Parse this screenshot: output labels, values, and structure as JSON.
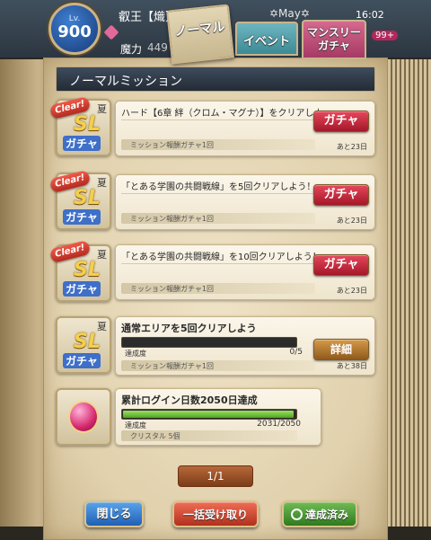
{
  "status": {
    "level_label": "Lv.",
    "level": "900",
    "player_name": "叡王【熾】",
    "player_sub": "✡May✡",
    "power_label": "魔力",
    "power_value": "449",
    "clock": "16:02",
    "badge": "99+"
  },
  "tabs": [
    {
      "label": "ノーマル"
    },
    {
      "label": "イベント"
    },
    {
      "label": "マンスリー\nガチャ"
    }
  ],
  "header": {
    "title": "ノーマルミッション"
  },
  "icon_common": {
    "clear_tag": "Clear!",
    "summer": "夏",
    "sl": "SL",
    "gacha": "ガチャ"
  },
  "missions": [
    {
      "title": "ハード【6章 絆（クロム・マグナ）】をクリアしよう",
      "reward": "ミッション報酬ガチャ1回",
      "button": "ガチャ",
      "remaining": "あと23日"
    },
    {
      "title": "「とある学園の共闘戦線」を5回クリアしよう！",
      "reward": "ミッション報酬ガチャ1回",
      "button": "ガチャ",
      "remaining": "あと23日"
    },
    {
      "title": "「とある学園の共闘戦線」を10回クリアしよう！",
      "reward": "ミッション報酬ガチャ1回",
      "button": "ガチャ",
      "remaining": "あと23日"
    },
    {
      "title": "通常エリアを5回クリアしよう",
      "progress_label": "達成度",
      "progress_text": "0/5",
      "progress_fraction": 0.0,
      "reward": "ミッション報酬ガチャ1回",
      "button": "詳細",
      "remaining": "あと38日"
    },
    {
      "title": "累計ログイン日数2050日達成",
      "progress_label": "達成度",
      "progress_text": "2031/2050",
      "progress_fraction": 0.99,
      "reward": "クリスタル 5個"
    }
  ],
  "pager": {
    "label": "1/1"
  },
  "footer": {
    "close": "閉じる",
    "collect_all": "一括受け取り",
    "completed": "達成済み"
  },
  "colors": {
    "header_bg": "#2c3541",
    "gacha_button": "#c92a3c",
    "detail_button": "#b27530",
    "progress_fill": "#6cc33a",
    "close_button": "#2f7bd0",
    "collect_button": "#d44a33",
    "completed_button": "#4e9a35"
  }
}
